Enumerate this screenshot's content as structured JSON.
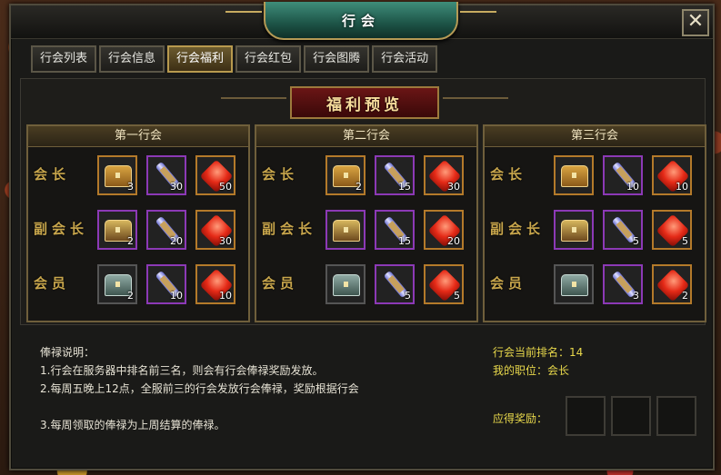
{
  "window": {
    "title": "行会",
    "close_label": "✕"
  },
  "tabs": [
    {
      "label": "行会列表",
      "active": false
    },
    {
      "label": "行会信息",
      "active": false
    },
    {
      "label": "行会福利",
      "active": true
    },
    {
      "label": "行会红包",
      "active": false
    },
    {
      "label": "行会图腾",
      "active": false
    },
    {
      "label": "行会活动",
      "active": false
    }
  ],
  "banner": "福利预览",
  "guilds": [
    {
      "title": "第一行会",
      "rows": [
        {
          "role": "会长",
          "items": [
            {
              "icon": "gold-chest-icon",
              "count": "3"
            },
            {
              "icon": "scroll-icon",
              "count": "30"
            },
            {
              "icon": "red-gem-icon",
              "count": "50"
            }
          ]
        },
        {
          "role": "副会长",
          "items": [
            {
              "icon": "purple-chest-icon",
              "count": "2"
            },
            {
              "icon": "scroll-icon",
              "count": "20"
            },
            {
              "icon": "red-gem-icon",
              "count": "30"
            }
          ]
        },
        {
          "role": "会员",
          "items": [
            {
              "icon": "silver-chest-icon",
              "count": "2"
            },
            {
              "icon": "scroll-icon",
              "count": "10"
            },
            {
              "icon": "red-gem-icon",
              "count": "10"
            }
          ]
        }
      ]
    },
    {
      "title": "第二行会",
      "rows": [
        {
          "role": "会长",
          "items": [
            {
              "icon": "gold-chest-icon",
              "count": "2"
            },
            {
              "icon": "scroll-icon",
              "count": "15"
            },
            {
              "icon": "red-gem-icon",
              "count": "30"
            }
          ]
        },
        {
          "role": "副会长",
          "items": [
            {
              "icon": "purple-chest-icon",
              "count": ""
            },
            {
              "icon": "scroll-icon",
              "count": "15"
            },
            {
              "icon": "red-gem-icon",
              "count": "20"
            }
          ]
        },
        {
          "role": "会员",
          "items": [
            {
              "icon": "silver-chest-icon",
              "count": ""
            },
            {
              "icon": "scroll-icon",
              "count": "5"
            },
            {
              "icon": "red-gem-icon",
              "count": "5"
            }
          ]
        }
      ]
    },
    {
      "title": "第三行会",
      "rows": [
        {
          "role": "会长",
          "items": [
            {
              "icon": "gold-chest-icon",
              "count": ""
            },
            {
              "icon": "scroll-icon",
              "count": "10"
            },
            {
              "icon": "red-gem-icon",
              "count": "10"
            }
          ]
        },
        {
          "role": "副会长",
          "items": [
            {
              "icon": "purple-chest-icon",
              "count": ""
            },
            {
              "icon": "scroll-icon",
              "count": "5"
            },
            {
              "icon": "red-gem-icon",
              "count": "5"
            }
          ]
        },
        {
          "role": "会员",
          "items": [
            {
              "icon": "silver-chest-icon",
              "count": ""
            },
            {
              "icon": "scroll-icon",
              "count": "3"
            },
            {
              "icon": "red-gem-icon",
              "count": "2"
            }
          ]
        }
      ]
    }
  ],
  "notes": {
    "heading": "俸禄说明：",
    "lines": [
      "1.行会在服务器中排名前三名，则会有行会俸禄奖励发放。",
      "2.每周五晚上12点，全服前三的行会发放行会俸禄，奖励根据行会",
      "",
      "3.每周领取的俸禄为上周结算的俸禄。"
    ]
  },
  "status": {
    "rank_label": "行会当前排名：",
    "rank_value": "14",
    "position_label": "我的职位：",
    "position_value": "会长",
    "reward_label": "应得奖励："
  }
}
